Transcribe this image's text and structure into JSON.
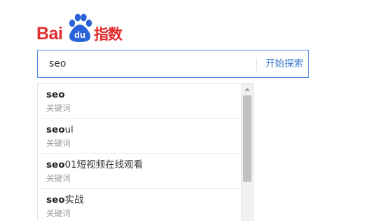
{
  "logo": {
    "bai": "Bai",
    "du": "du",
    "zhishu": "指数",
    "brand_red": "#e02d2d",
    "brand_blue": "#2a63d9"
  },
  "search": {
    "value": "seo",
    "button_label": "开始探索",
    "border_color": "#4e8de8"
  },
  "suggestions": [
    {
      "highlight": "seo",
      "rest": "",
      "type": "关键词"
    },
    {
      "highlight": "seo",
      "rest": "ul",
      "type": "关键词"
    },
    {
      "highlight": "seo",
      "rest": "01短视频在线观看",
      "type": "关键词"
    },
    {
      "highlight": "seo",
      "rest": "实战",
      "type": "关键词"
    }
  ]
}
